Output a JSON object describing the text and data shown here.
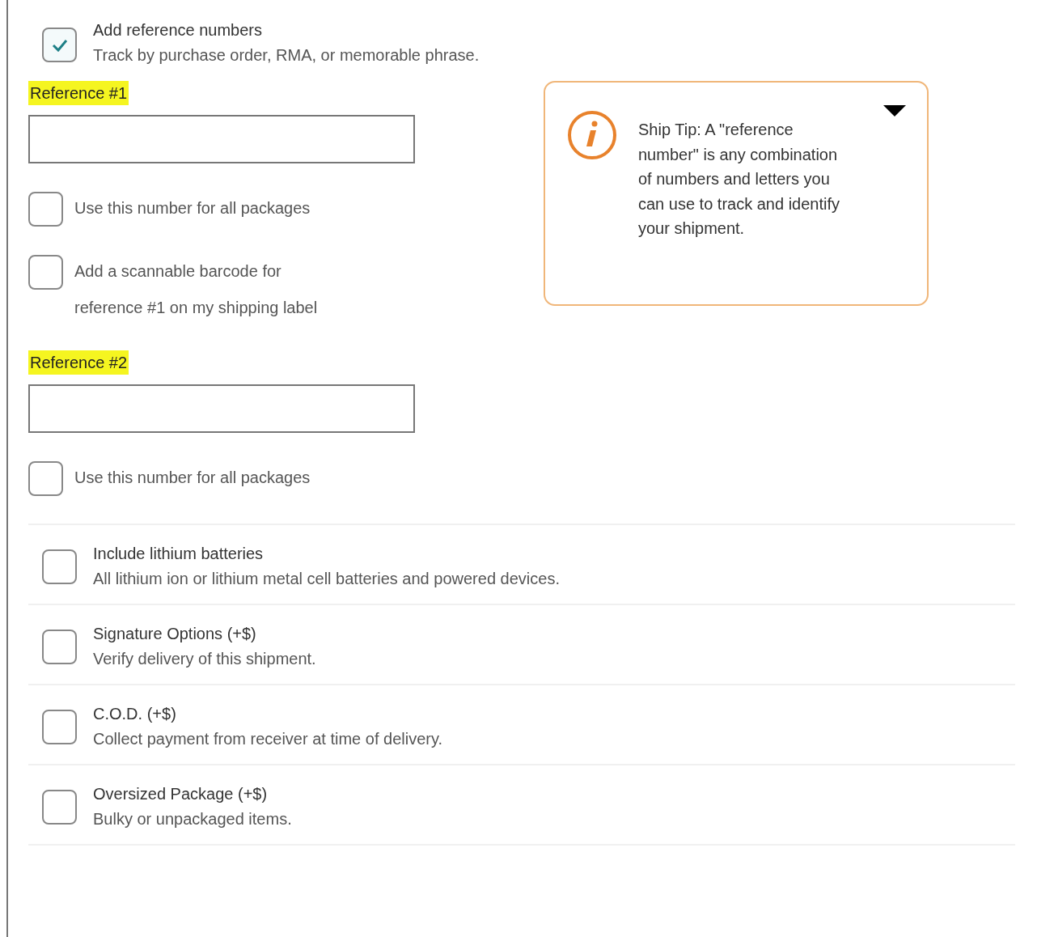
{
  "reference_toggle": {
    "title": "Add reference numbers",
    "description": "Track by purchase order, RMA, or memorable phrase.",
    "checked": true
  },
  "references": [
    {
      "label": "Reference #1",
      "options": [
        {
          "label": "Use this number for all packages",
          "checked": false
        },
        {
          "label": "Add a scannable barcode for reference #1 on my shipping label",
          "checked": false
        }
      ]
    },
    {
      "label": "Reference #2",
      "options": [
        {
          "label": "Use this number for all packages",
          "checked": false
        }
      ]
    }
  ],
  "ship_tip": {
    "text": "Ship Tip: A \"reference number\" is any combination of numbers and letters you can use to track and identify your shipment.",
    "expanded": true
  },
  "options": [
    {
      "title": "Include lithium batteries",
      "description": "All lithium ion or lithium metal cell batteries and powered devices.",
      "checked": false
    },
    {
      "title": "Signature Options (+$)",
      "description": "Verify delivery of this shipment.",
      "checked": false
    },
    {
      "title": "C.O.D. (+$)",
      "description": "Collect payment from receiver at time of delivery.",
      "checked": false
    },
    {
      "title": "Oversized Package (+$)",
      "description": "Bulky or unpackaged items.",
      "checked": false
    }
  ]
}
